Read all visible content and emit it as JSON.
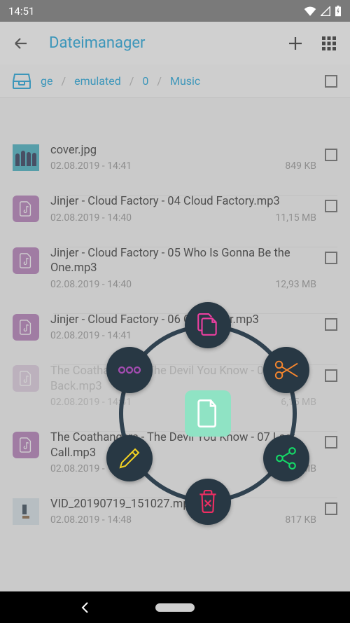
{
  "statusbar": {
    "time": "14:51"
  },
  "header": {
    "title": "Dateimanager"
  },
  "breadcrumb": {
    "c0": "ge",
    "c1": "emulated",
    "c2": "0",
    "c3": "Music"
  },
  "files": [
    {
      "name": "cover.jpg",
      "date": "02.08.2019 - 14:41",
      "size": "849 KB"
    },
    {
      "name": "Jinjer - Cloud Factory - 04 Cloud Factory.mp3",
      "date": "02.08.2019 - 14:40",
      "size": "11,15 MB"
    },
    {
      "name": "Jinjer - Cloud Factory - 05 Who Is Gonna Be the One.mp3",
      "date": "02.08.2019 - 14:40",
      "size": "12,93 MB"
    },
    {
      "name": "Jinjer - Cloud Factory - 06 Outlander.mp3",
      "date": "02.08.2019 - 14:41",
      "size": ""
    },
    {
      "name": "The Coathangers - The Devil You Know - 05 Step Back.mp3",
      "date": "02.08.2019 - 14:41",
      "size": "6,15 MB"
    },
    {
      "name": "The Coathangers - The Devil You Know - 07 Last Call.mp3",
      "date": "02.08.2019 - 14:41",
      "size": "7,78 MB"
    },
    {
      "name": "VID_20190719_151027.mp4",
      "date": "02.08.2019 - 14:48",
      "size": "817 KB"
    }
  ],
  "radial": {
    "center": "file-icon",
    "buttons": [
      "copy",
      "cut",
      "share",
      "delete",
      "edit",
      "more"
    ]
  }
}
